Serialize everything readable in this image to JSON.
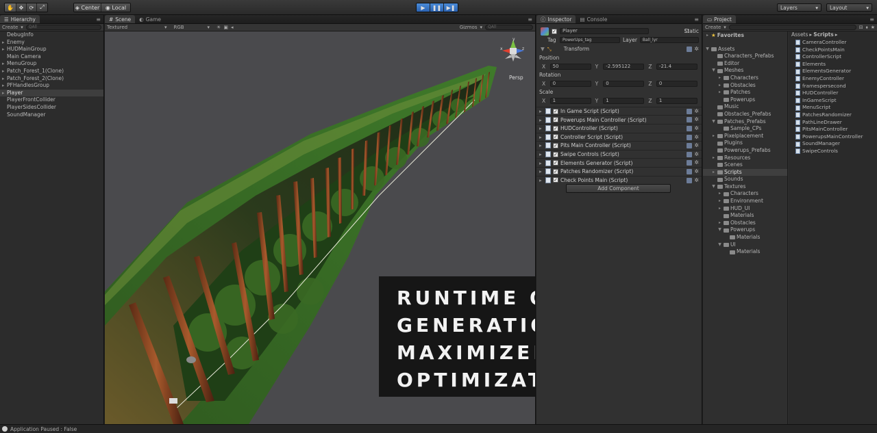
{
  "toolbar": {
    "pivot": "Center",
    "space": "Local",
    "layers": "Layers",
    "layout": "Layout",
    "tool_icons": [
      "hand-icon",
      "move-icon",
      "rotate-icon",
      "scale-icon"
    ]
  },
  "hierarchy": {
    "tab": "Hierarchy",
    "create": "Create",
    "search_placeholder": "QAll",
    "items": [
      {
        "label": "DebugInfo",
        "expandable": false
      },
      {
        "label": "Enemy",
        "expandable": true
      },
      {
        "label": "HUDMainGroup",
        "expandable": true
      },
      {
        "label": "Main Camera",
        "expandable": false
      },
      {
        "label": "MenuGroup",
        "expandable": true
      },
      {
        "label": "Patch_Forest_1(Clone)",
        "expandable": true
      },
      {
        "label": "Patch_Forest_2(Clone)",
        "expandable": true
      },
      {
        "label": "PFHandlesGroup",
        "expandable": true
      },
      {
        "label": "Player",
        "expandable": true,
        "selected": true
      },
      {
        "label": "PlayerFrontCollider",
        "expandable": false
      },
      {
        "label": "PlayerSidesCollider",
        "expandable": false
      },
      {
        "label": "SoundManager",
        "expandable": false
      }
    ]
  },
  "scene": {
    "tab_scene": "Scene",
    "tab_game": "Game",
    "shading": "Textured",
    "render_mode": "RGB",
    "gizmos": "Gizmos",
    "search_placeholder": "QAll",
    "persp": "Persp",
    "gizmo_axes": {
      "y": "y",
      "x": "x",
      "z": "z"
    },
    "overlay_text": "Runtime object generation for maximized optimization"
  },
  "inspector": {
    "tab_inspector": "Inspector",
    "tab_console": "Console",
    "object_name": "Player",
    "static_label": "Static",
    "tag_label": "Tag",
    "tag_value": "PowerUps_tag",
    "layer_label": "Layer",
    "layer_value": "Ball_lyr",
    "transform_label": "Transform",
    "position_label": "Position",
    "rotation_label": "Rotation",
    "scale_label": "Scale",
    "position": {
      "x": "50",
      "y": "-2.595122",
      "z": "-21.4"
    },
    "rotation": {
      "x": "0",
      "y": "0",
      "z": "0"
    },
    "scale": {
      "x": "1",
      "y": "1",
      "z": "1"
    },
    "axis": {
      "x": "X",
      "y": "Y",
      "z": "Z"
    },
    "components": [
      "In Game Script (Script)",
      "Powerups Main Controller (Script)",
      "HUDController (Script)",
      "Controller Script (Script)",
      "Pits Main Controller (Script)",
      "Swipe Controls (Script)",
      "Elements Generator (Script)",
      "Patches Randomizer (Script)",
      "Check Points Main (Script)"
    ],
    "add_component": "Add Component"
  },
  "project": {
    "tab": "Project",
    "create": "Create",
    "favorites": "Favorites",
    "tree": [
      {
        "label": "Assets",
        "depth": 0,
        "toggle": "▼"
      },
      {
        "label": "Characters_Prefabs",
        "depth": 1,
        "toggle": ""
      },
      {
        "label": "Editor",
        "depth": 1,
        "toggle": ""
      },
      {
        "label": "Meshes",
        "depth": 1,
        "toggle": "▼"
      },
      {
        "label": "Characters",
        "depth": 2,
        "toggle": "▸"
      },
      {
        "label": "Obstacles",
        "depth": 2,
        "toggle": "▸"
      },
      {
        "label": "Patches",
        "depth": 2,
        "toggle": "▸"
      },
      {
        "label": "Powerups",
        "depth": 2,
        "toggle": ""
      },
      {
        "label": "Music",
        "depth": 1,
        "toggle": ""
      },
      {
        "label": "Obstacles_Prefabs",
        "depth": 1,
        "toggle": ""
      },
      {
        "label": "Patches_Prefabs",
        "depth": 1,
        "toggle": "▼"
      },
      {
        "label": "Sample_CPs",
        "depth": 2,
        "toggle": ""
      },
      {
        "label": "Pixelplacement",
        "depth": 1,
        "toggle": "▸"
      },
      {
        "label": "Plugins",
        "depth": 1,
        "toggle": ""
      },
      {
        "label": "Powerups_Prefabs",
        "depth": 1,
        "toggle": ""
      },
      {
        "label": "Resources",
        "depth": 1,
        "toggle": "▸"
      },
      {
        "label": "Scenes",
        "depth": 1,
        "toggle": ""
      },
      {
        "label": "Scripts",
        "depth": 1,
        "toggle": "▸",
        "selected": true
      },
      {
        "label": "Sounds",
        "depth": 1,
        "toggle": ""
      },
      {
        "label": "Textures",
        "depth": 1,
        "toggle": "▼"
      },
      {
        "label": "Characters",
        "depth": 2,
        "toggle": "▸"
      },
      {
        "label": "Environment",
        "depth": 2,
        "toggle": "▸"
      },
      {
        "label": "HUD_UI",
        "depth": 2,
        "toggle": "▸"
      },
      {
        "label": "Materials",
        "depth": 2,
        "toggle": ""
      },
      {
        "label": "Obstacles",
        "depth": 2,
        "toggle": "▸"
      },
      {
        "label": "Powerups",
        "depth": 2,
        "toggle": "▼"
      },
      {
        "label": "Materials",
        "depth": 3,
        "toggle": ""
      },
      {
        "label": "UI",
        "depth": 2,
        "toggle": "▼"
      },
      {
        "label": "Materials",
        "depth": 3,
        "toggle": ""
      }
    ],
    "breadcrumb_root": "Assets",
    "breadcrumb_sep": "▸",
    "breadcrumb_current": "Scripts",
    "files": [
      "CameraController",
      "CheckPointsMain",
      "ControllerScript",
      "Elements",
      "ElementsGenerator",
      "EnemyController",
      "framespersecond",
      "HUDController",
      "InGameScript",
      "MenuScript",
      "PatchesRandomizer",
      "PathLineDrawer",
      "PitsMainController",
      "PowerupsMainController",
      "SoundManager",
      "SwipeControls"
    ]
  },
  "status": {
    "message": "Application Paused : False"
  }
}
